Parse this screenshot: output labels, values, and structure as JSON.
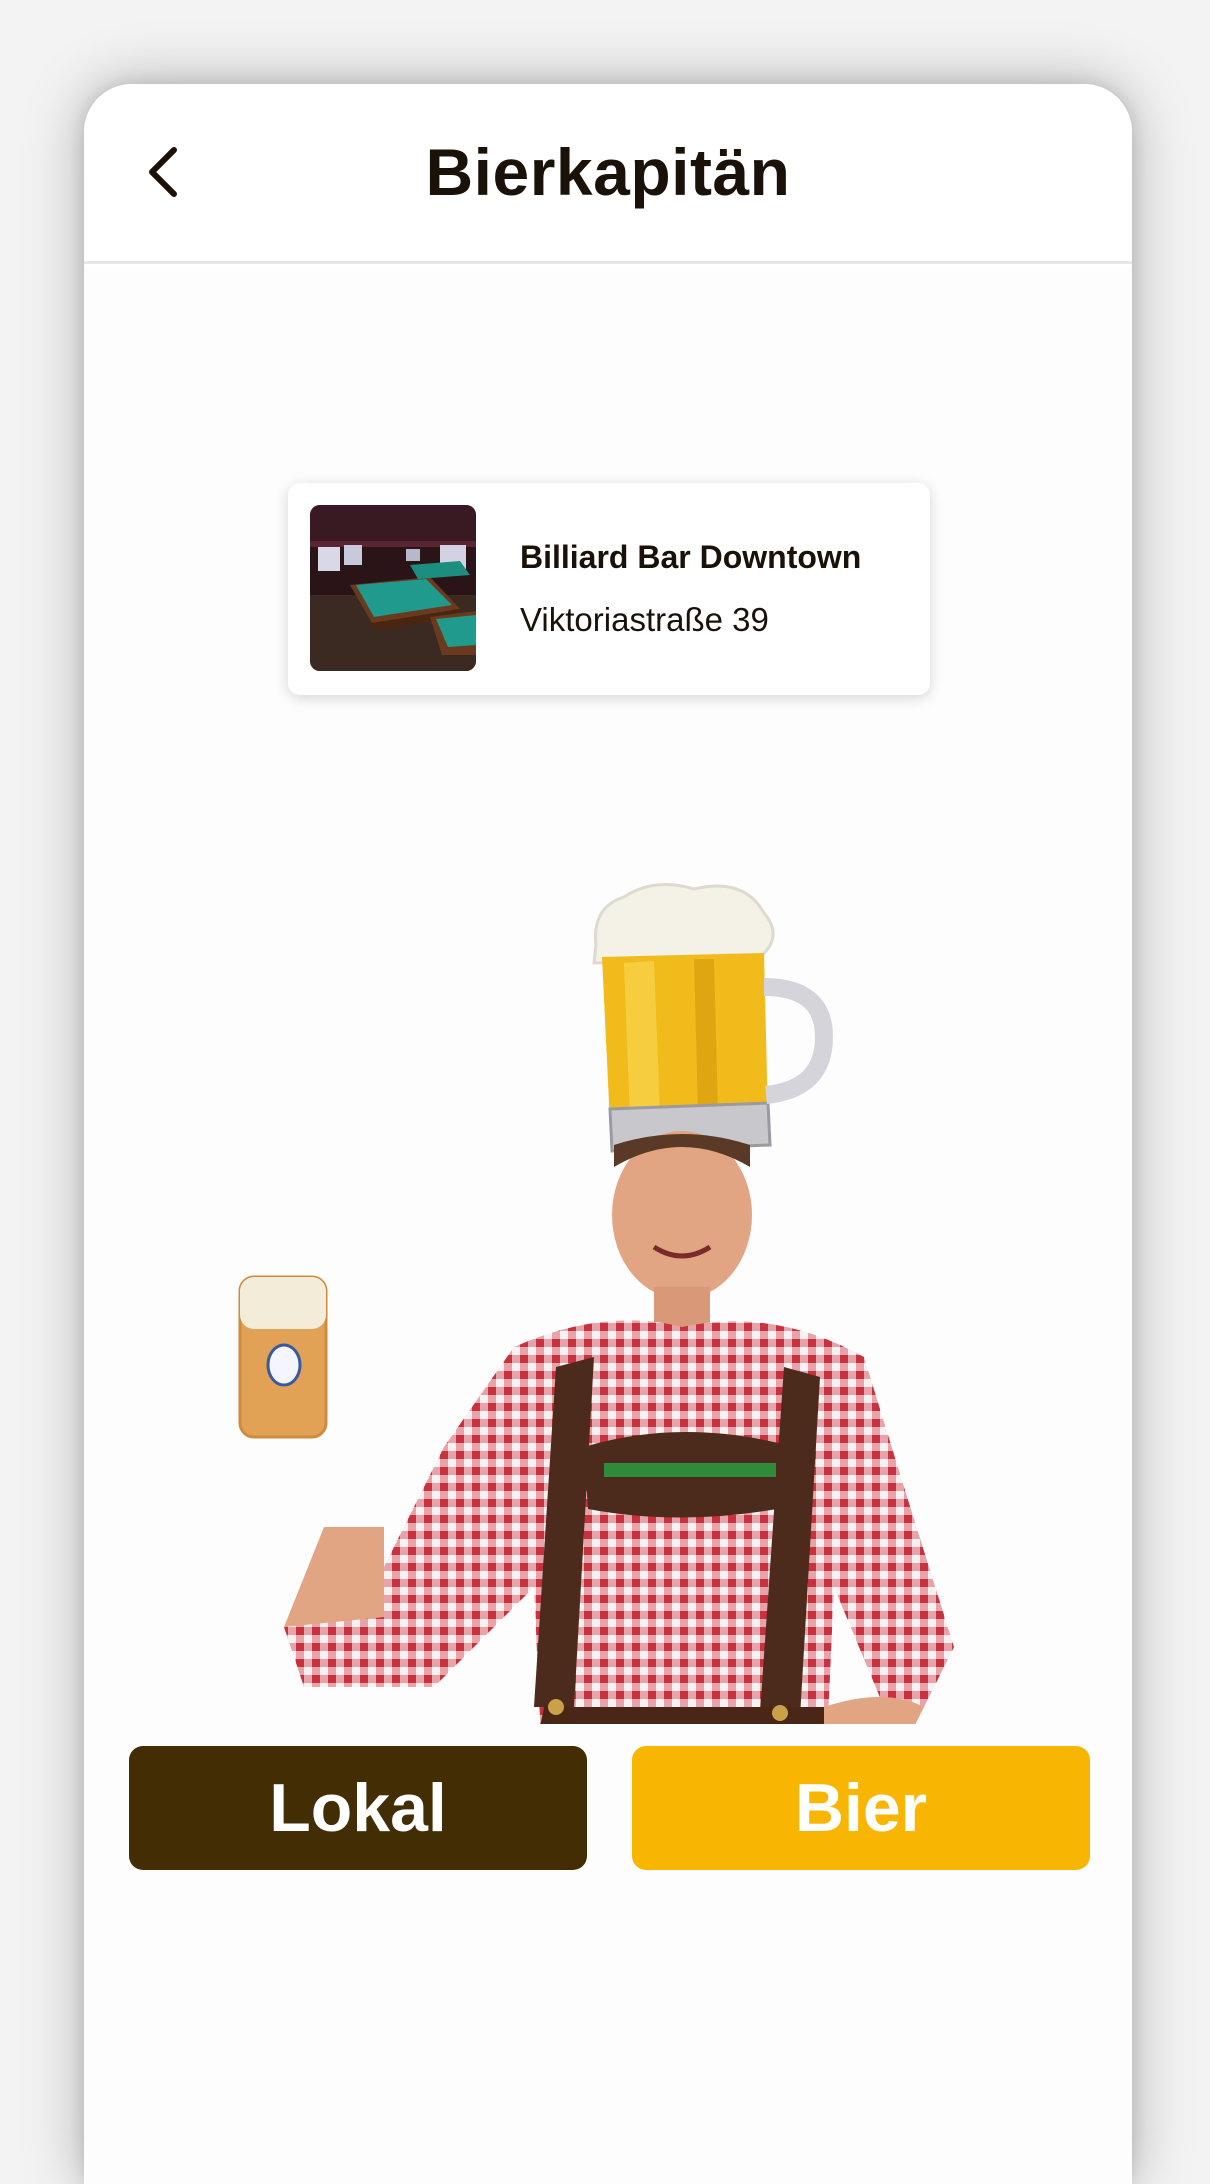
{
  "header": {
    "title": "Bierkapitän",
    "back_icon": "chevron-left-icon"
  },
  "place": {
    "name": "Billiard Bar Downtown",
    "address": "Viktoriastraße 39",
    "image": "billiard-room-photo"
  },
  "mascot": {
    "image": "man-in-lederhosen-with-beer-mug-hat"
  },
  "actions": {
    "lokal_label": "Lokal",
    "bier_label": "Bier"
  },
  "colors": {
    "lokal_button": "#432d05",
    "bier_button": "#f8b502",
    "title_text": "#1a1209"
  }
}
